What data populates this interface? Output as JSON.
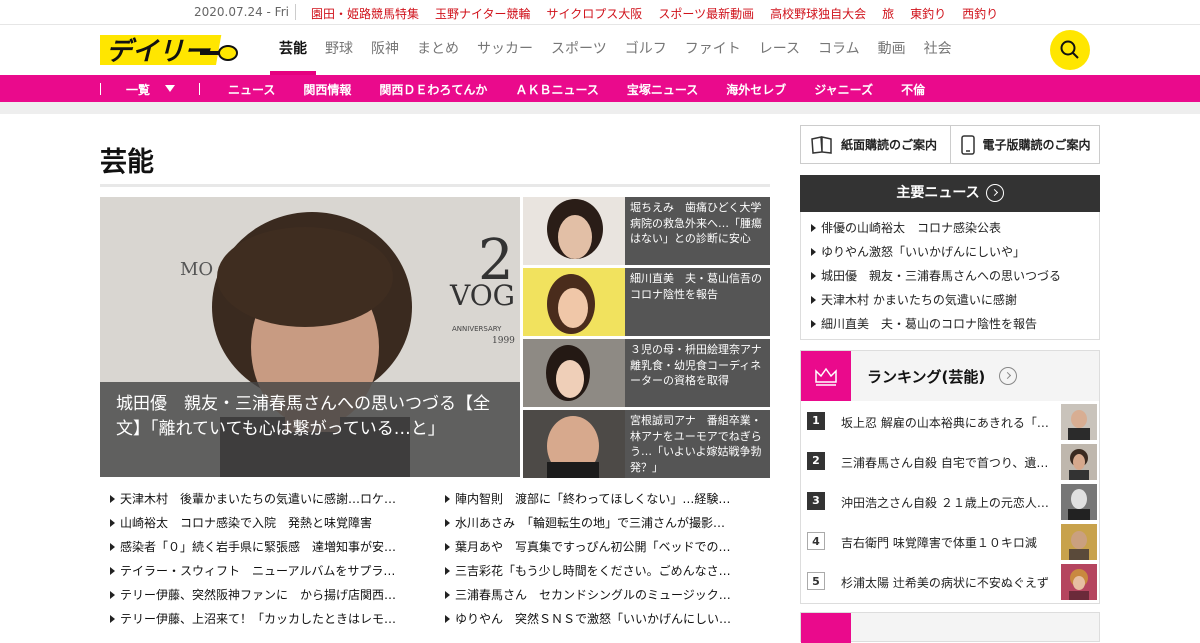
{
  "topbar": {
    "date": "2020.07.24 - Fri",
    "links": [
      "園田・姫路競馬特集",
      "玉野ナイター競輪",
      "サイクロプス大阪",
      "スポーツ最新動画",
      "高校野球独自大会",
      "旅",
      "東釣り",
      "西釣り"
    ]
  },
  "header": {
    "logo_text": "デイリー",
    "nav": [
      "芸能",
      "野球",
      "阪神",
      "まとめ",
      "サッカー",
      "スポーツ",
      "ゴルフ",
      "ファイト",
      "レース",
      "コラム",
      "動画",
      "社会"
    ],
    "active_nav": "芸能",
    "search_icon": "search-icon"
  },
  "subnav": {
    "ichiran": "一覧",
    "links": [
      "ニュース",
      "関西情報",
      "関西ＤＥわろてんか",
      "ＡＫＢニュース",
      "宝塚ニュース",
      "海外セレブ",
      "ジャニーズ",
      "不倫"
    ]
  },
  "main": {
    "page_title": "芸能",
    "hero": {
      "caption": "城田優　親友・三浦春馬さんへの思いつづる【全文】「離れていても心は繋がっている…と」",
      "backdrop_text": "2",
      "backdrop_small": "MO",
      "backdrop_vog": "VOG",
      "backdrop_anniv": "ANNIVERSARY",
      "backdrop_year": "1999"
    },
    "side_cards": [
      {
        "text": "堀ちえみ　歯痛ひどく大学病院の救急外来へ…「腫瘍はない」との診断に安心"
      },
      {
        "text": "細川直美　夫・葛山信吾のコロナ陰性を報告"
      },
      {
        "text": "３児の母・枡田絵理奈アナ　離乳食・幼児食コーディネーターの資格を取得"
      },
      {
        "text": "宮根誠司アナ　番組卒業・林アナをユーモアでねぎらう…「いよいよ嫁姑戦争勃発？」"
      }
    ],
    "articles_left": [
      "天津木村　後輩かまいたちの気遣いに感謝…ロケ…",
      "山崎裕太　コロナ感染で入院　発熱と味覚障害",
      "感染者「０」続く岩手県に緊張感　達増知事が安…",
      "テイラー・スウィフト　ニューアルバムをサプラ…",
      "テリー伊藤、突然阪神ファンに　から揚げ店関西…",
      "テリー伊藤、上沼来て！「カッカしたときはレモ…"
    ],
    "articles_right": [
      "陣内智則　渡部に「終わってほしくない」…経験…",
      "水川あさみ　「輪廻転生の地」で三浦さんが撮影…",
      "葉月あや　写真集ですっぴん初公開「ベッドでの…",
      "三吉彩花「もう少し時間をください。ごめんなさ…",
      "三浦春馬さん　セカンドシングルのミュージック…",
      "ゆりやん　突然ＳＮＳで激怒「いいかげんにしい…"
    ]
  },
  "sidebar": {
    "subscribe_paper": "紙面購読のご案内",
    "subscribe_digital": "電子版購読のご案内",
    "major_news_title": "主要ニュース",
    "major_news": [
      "俳優の山崎裕太　コロナ感染公表",
      "ゆりやん激怒「いいかげんにしいや」",
      "城田優　親友・三浦春馬さんへの思いつづる",
      "天津木村 かまいたちの気遣いに感謝",
      "細川直美　夫・葛山のコロナ陰性を報告"
    ],
    "ranking_title": "ランキング(芸能)",
    "ranking": [
      {
        "rank": "1",
        "title": "坂上忍 解雇の山本裕典にあきれる「…"
      },
      {
        "rank": "2",
        "title": "三浦春馬さん自殺 自宅で首つり、遺…"
      },
      {
        "rank": "3",
        "title": "沖田浩之さん自殺 ２１歳上の元恋人…"
      },
      {
        "rank": "4",
        "title": "吉右衛門 味覚障害で体重１０キロ減"
      },
      {
        "rank": "5",
        "title": "杉浦太陽 辻希美の病状に不安ぬぐえず"
      }
    ]
  }
}
